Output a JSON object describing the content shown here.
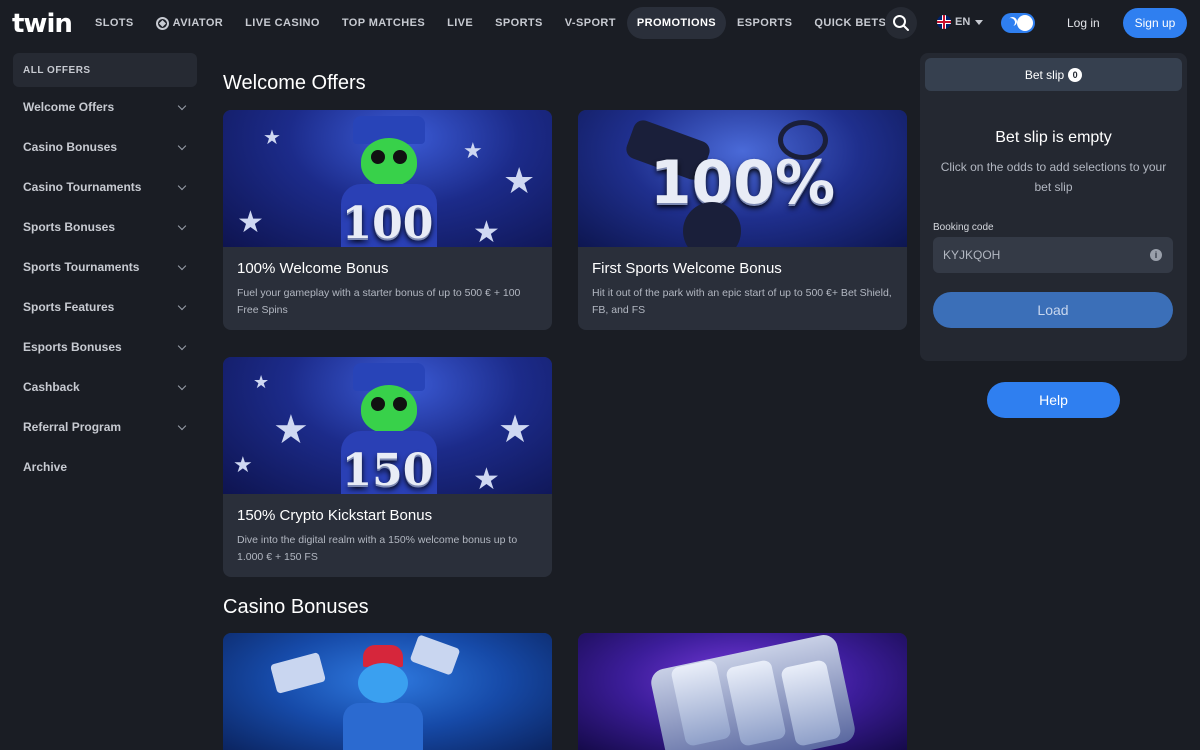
{
  "brand": {
    "logo": "twin"
  },
  "nav": {
    "items": [
      {
        "label": "SLOTS"
      },
      {
        "label": "AVIATOR"
      },
      {
        "label": "LIVE CASINO"
      },
      {
        "label": "TOP MATCHES"
      },
      {
        "label": "LIVE"
      },
      {
        "label": "SPORTS"
      },
      {
        "label": "V-SPORT"
      },
      {
        "label": "PROMOTIONS",
        "active": true
      },
      {
        "label": "ESPORTS"
      },
      {
        "label": "QUICK BETS"
      }
    ]
  },
  "header": {
    "language": "EN",
    "login": "Log in",
    "signup": "Sign up",
    "accent_color": "#2f7ff0"
  },
  "sidebar": {
    "all_offers": "ALL OFFERS",
    "items": [
      {
        "label": "Welcome Offers"
      },
      {
        "label": "Casino Bonuses"
      },
      {
        "label": "Casino Tournaments"
      },
      {
        "label": "Sports Bonuses"
      },
      {
        "label": "Sports Tournaments"
      },
      {
        "label": "Sports Features"
      },
      {
        "label": "Esports Bonuses"
      },
      {
        "label": "Cashback"
      },
      {
        "label": "Referral Program"
      },
      {
        "label": "Archive"
      }
    ]
  },
  "sections": [
    {
      "title": "Welcome Offers",
      "cards": [
        {
          "title": "100% Welcome Bonus",
          "desc": "Fuel your gameplay with a starter bonus of up to 500 € + 100 Free Spins",
          "art_text": "100"
        },
        {
          "title": "First Sports Welcome Bonus",
          "desc": "Hit it out of the park with an epic start of up to 500 €+ Bet Shield, FB, and FS",
          "art_text": "100%"
        },
        {
          "title": "150% Crypto Kickstart Bonus",
          "desc": "Dive into the digital realm with a 150% welcome bonus up to 1.000 € + 150 FS",
          "art_text": "150"
        }
      ]
    },
    {
      "title": "Casino Bonuses"
    }
  ],
  "betslip": {
    "tab_label": "Bet slip",
    "count": "0",
    "empty_title": "Bet slip is empty",
    "hint": "Click on the odds to add selections to your bet slip",
    "booking_label": "Booking code",
    "booking_value": "KYJKQOH",
    "load_label": "Load"
  },
  "help_label": "Help"
}
